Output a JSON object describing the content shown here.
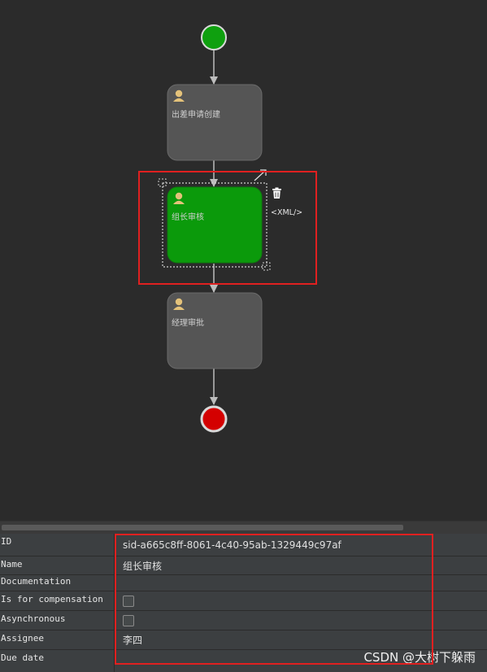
{
  "colors": {
    "canvas_bg": "#2b2b2b",
    "task_bg": "#555555",
    "selected_task_bg": "#0b9a0b",
    "start_event": "#0fa00f",
    "end_event": "#d40000",
    "highlight": "#e02020"
  },
  "diagram": {
    "tasks": [
      {
        "id": "task1",
        "label": "出差申请创建",
        "icon": "user-icon",
        "selected": false
      },
      {
        "id": "task2",
        "label": "组长审核",
        "icon": "user-icon",
        "selected": true
      },
      {
        "id": "task3",
        "label": "经理审批",
        "icon": "user-icon",
        "selected": false
      }
    ],
    "toolbar": {
      "delete_icon": "trash-icon",
      "xml_label": "<XML/>"
    }
  },
  "properties": [
    {
      "key": "id",
      "label": "ID",
      "type": "text",
      "value": "sid-a665c8ff-8061-4c40-95ab-1329449c97af"
    },
    {
      "key": "name",
      "label": "Name",
      "type": "text",
      "value": "组长审核"
    },
    {
      "key": "documentation",
      "label": "Documentation",
      "type": "text",
      "value": ""
    },
    {
      "key": "is_for_compensation",
      "label": "Is for compensation",
      "type": "checkbox",
      "value": false
    },
    {
      "key": "asynchronous",
      "label": "Asynchronous",
      "type": "checkbox",
      "value": false
    },
    {
      "key": "assignee",
      "label": "Assignee",
      "type": "text",
      "value": "李四"
    },
    {
      "key": "due_date",
      "label": "Due date",
      "type": "text",
      "value": ""
    }
  ],
  "watermark": "CSDN @大树下躲雨"
}
